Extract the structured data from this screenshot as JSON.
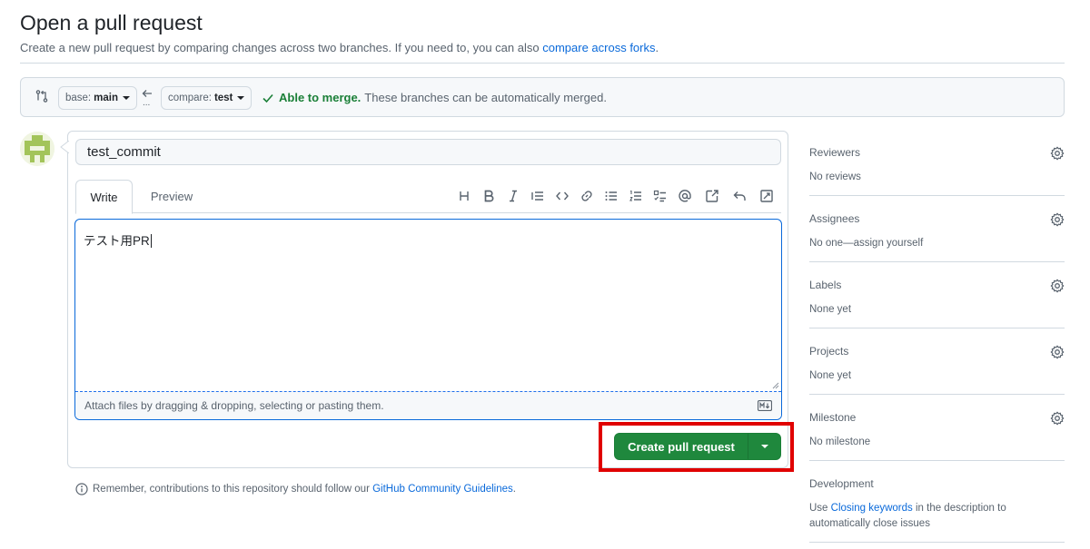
{
  "header": {
    "title": "Open a pull request",
    "subtitle_prefix": "Create a new pull request by comparing changes across two branches. If you need to, you can also",
    "subtitle_link": "compare across forks",
    "subtitle_suffix": "."
  },
  "compare": {
    "base_label": "base:",
    "base_value": "main",
    "compare_label": "compare:",
    "compare_value": "test",
    "arrow_dots": "...",
    "merge_ok": "Able to merge.",
    "merge_text": "These branches can be automatically merged."
  },
  "form": {
    "title_value": "test_commit",
    "tabs": {
      "write": "Write",
      "preview": "Preview"
    },
    "body_text": "テスト用PR",
    "attach_text": "Attach files by dragging & dropping, selecting or pasting them.",
    "create_button": "Create pull request"
  },
  "reminder": {
    "prefix": "Remember, contributions to this repository should follow our",
    "link": "GitHub Community Guidelines",
    "suffix": "."
  },
  "sidebar": {
    "reviewers": {
      "title": "Reviewers",
      "value": "No reviews"
    },
    "assignees": {
      "title": "Assignees",
      "value_prefix": "No one—",
      "value_link": "assign yourself"
    },
    "labels": {
      "title": "Labels",
      "value": "None yet"
    },
    "projects": {
      "title": "Projects",
      "value": "None yet"
    },
    "milestone": {
      "title": "Milestone",
      "value": "No milestone"
    },
    "development": {
      "title": "Development",
      "value_prefix": "Use",
      "value_link": "Closing keywords",
      "value_suffix": "in the description to automatically close issues"
    }
  },
  "colors": {
    "accent": "#0969da",
    "success": "#1a7f37",
    "primary_button": "#1f883d",
    "highlight": "#e00000"
  },
  "icons": {
    "toolbar": [
      "heading-icon",
      "bold-icon",
      "italic-icon",
      "quote-icon",
      "code-icon",
      "link-icon",
      "unordered-list-icon",
      "ordered-list-icon",
      "task-list-icon",
      "mention-icon",
      "cross-reference-icon",
      "undo-icon",
      "fullscreen-icon"
    ]
  }
}
